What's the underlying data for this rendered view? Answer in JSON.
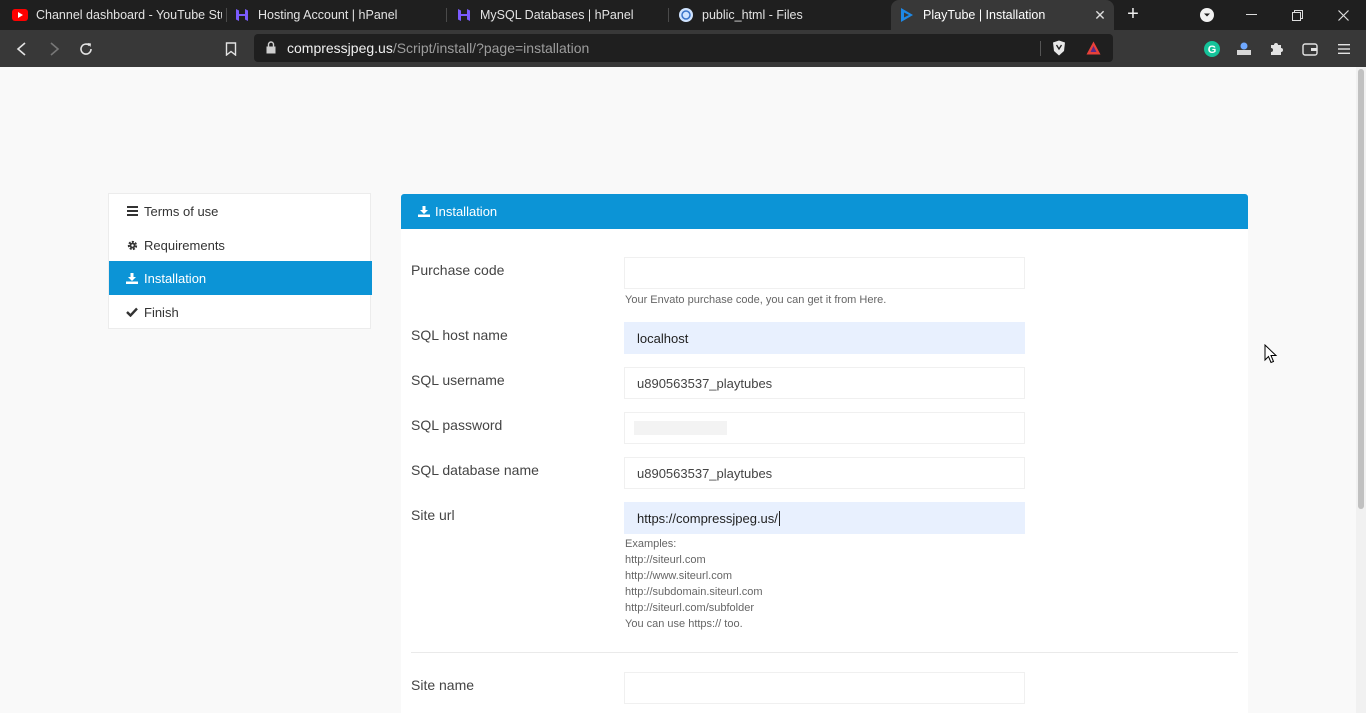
{
  "browser": {
    "tabs": [
      {
        "title": "Channel dashboard - YouTube Stud",
        "icon": "youtube-icon"
      },
      {
        "title": "Hosting Account | hPanel",
        "icon": "hostinger-icon"
      },
      {
        "title": "MySQL Databases | hPanel",
        "icon": "hostinger-icon"
      },
      {
        "title": "public_html - Files",
        "icon": "files-icon"
      },
      {
        "title": "PlayTube | Installation",
        "icon": "playtube-icon",
        "active": true
      }
    ],
    "url_host": "compressjpeg.us",
    "url_path": "/Script/install/?page=installation"
  },
  "sidebar": {
    "items": [
      {
        "label": "Terms of use",
        "icon": "list-icon"
      },
      {
        "label": "Requirements",
        "icon": "gear-icon"
      },
      {
        "label": "Installation",
        "icon": "download-icon",
        "active": true
      },
      {
        "label": "Finish",
        "icon": "check-icon"
      }
    ]
  },
  "panel": {
    "title": "Installation",
    "fields": {
      "purchase_code": {
        "label": "Purchase code",
        "value": "",
        "help": "Your Envato purchase code, you can get it from Here."
      },
      "sql_host": {
        "label": "SQL host name",
        "value": "localhost"
      },
      "sql_user": {
        "label": "SQL username",
        "value": "u890563537_playtubes"
      },
      "sql_password": {
        "label": "SQL password",
        "value": ""
      },
      "sql_db": {
        "label": "SQL database name",
        "value": "u890563537_playtubes"
      },
      "site_url": {
        "label": "Site url",
        "value": "https://compressjpeg.us/"
      },
      "site_name": {
        "label": "Site name",
        "value": ""
      }
    },
    "site_url_help": [
      "Examples:",
      "http://siteurl.com",
      "http://www.siteurl.com",
      "http://subdomain.siteurl.com",
      "http://siteurl.com/subfolder",
      "You can use https:// too."
    ]
  },
  "colors": {
    "accent": "#0c94d6",
    "autofill": "#e8f0fe",
    "chrome_dark": "#1f1f1f",
    "chrome_toolbar": "#383838"
  }
}
